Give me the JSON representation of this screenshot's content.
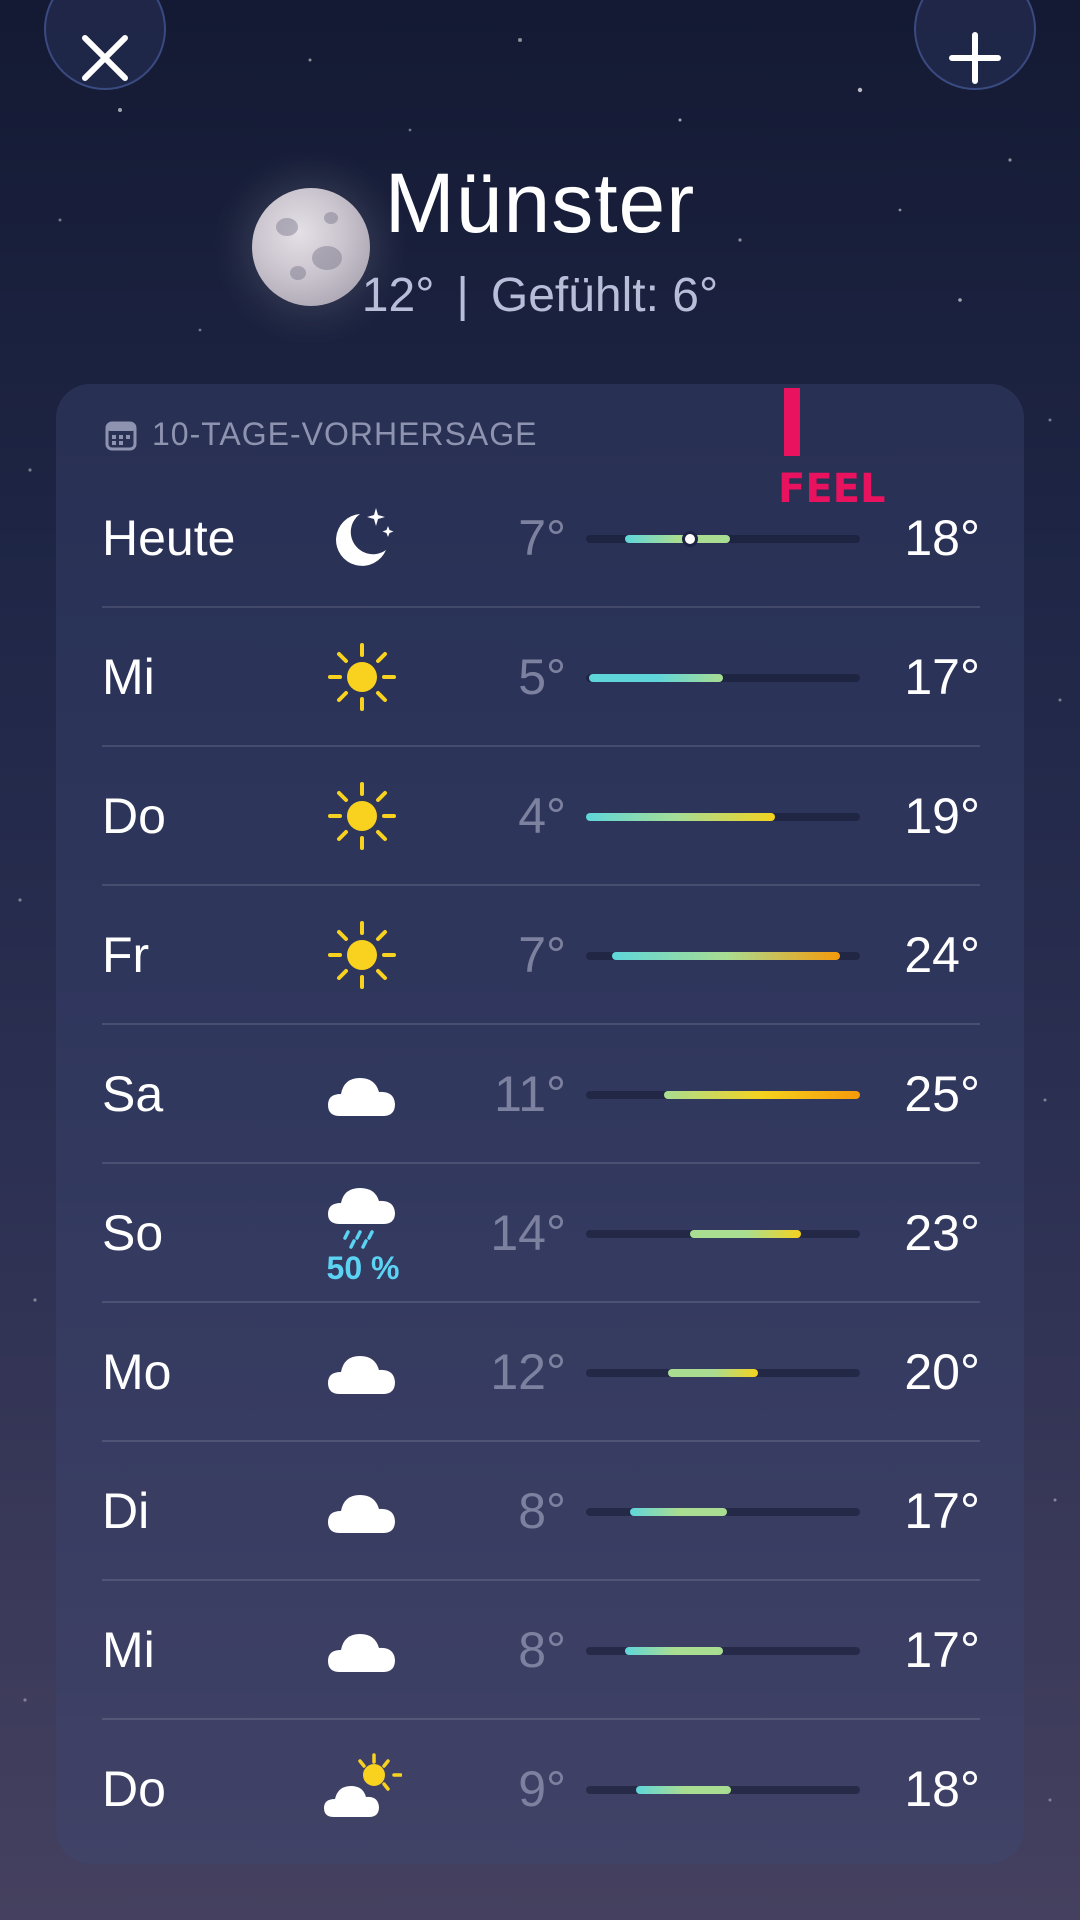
{
  "header": {
    "close_icon": "close-icon",
    "add_icon": "plus-icon",
    "city": "Münster",
    "current_temp": "12°",
    "separator": "|",
    "feels_like": "Gefühlt: 6°"
  },
  "forecast": {
    "title": "10-TAGE-VORHERSAGE",
    "title_icon": "calendar-icon",
    "range_min": 4,
    "range_max": 25,
    "current_temp_value": 12,
    "days": [
      {
        "day": "Heute",
        "icon": "moon-stars-icon",
        "low": "7°",
        "high": "18°",
        "low_val": 7,
        "high_val": 15,
        "current": true
      },
      {
        "day": "Mi",
        "icon": "sun-icon",
        "low": "5°",
        "high": "17°",
        "low_val": 4.2,
        "high_val": 14.5
      },
      {
        "day": "Do",
        "icon": "sun-icon",
        "low": "4°",
        "high": "19°",
        "low_val": 4,
        "high_val": 18.5
      },
      {
        "day": "Fr",
        "icon": "sun-icon",
        "low": "7°",
        "high": "24°",
        "low_val": 6,
        "high_val": 23.5
      },
      {
        "day": "Sa",
        "icon": "cloud-icon",
        "low": "11°",
        "high": "25°",
        "low_val": 10,
        "high_val": 25
      },
      {
        "day": "So",
        "icon": "cloud-rain-icon",
        "low": "14°",
        "high": "23°",
        "low_val": 12,
        "high_val": 20.5,
        "precip": "50 %"
      },
      {
        "day": "Mo",
        "icon": "cloud-icon",
        "low": "12°",
        "high": "20°",
        "low_val": 10.3,
        "high_val": 17.2
      },
      {
        "day": "Di",
        "icon": "cloud-icon",
        "low": "8°",
        "high": "17°",
        "low_val": 7.4,
        "high_val": 14.8
      },
      {
        "day": "Mi",
        "icon": "cloud-icon",
        "low": "8°",
        "high": "17°",
        "low_val": 7,
        "high_val": 14.5
      },
      {
        "day": "Do",
        "icon": "cloud-sun-icon",
        "low": "9°",
        "high": "18°",
        "low_val": 7.8,
        "high_val": 15.1
      }
    ]
  },
  "badge": {
    "text": "FEEL",
    "color": "#e8125f"
  },
  "colors": {
    "cool": "#5fd6da",
    "mild": "#a8dd92",
    "warm": "#f5d21e",
    "hot": "#f59a0a"
  }
}
